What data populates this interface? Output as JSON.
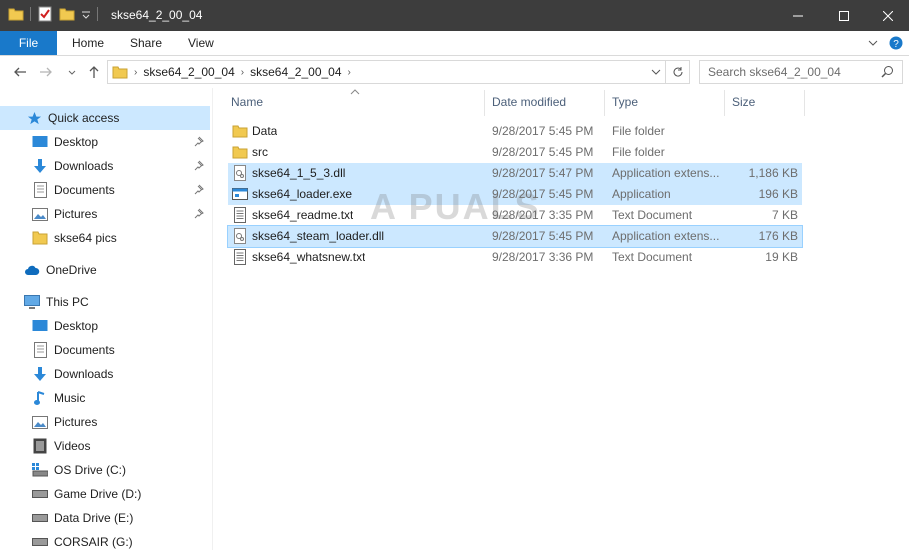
{
  "window": {
    "title": "skse64_2_00_04"
  },
  "ribbon": {
    "tabs": [
      "File",
      "Home",
      "Share",
      "View"
    ]
  },
  "nav": {
    "breadcrumbs": [
      "skse64_2_00_04",
      "skse64_2_00_04"
    ],
    "search_placeholder": "Search skse64_2_00_04"
  },
  "sidebar": {
    "quick_access": {
      "label": "Quick access"
    },
    "quick_items": [
      {
        "label": "Desktop",
        "icon": "desktop-icon",
        "pinned": true
      },
      {
        "label": "Downloads",
        "icon": "downloads-icon",
        "pinned": true
      },
      {
        "label": "Documents",
        "icon": "documents-icon",
        "pinned": true
      },
      {
        "label": "Pictures",
        "icon": "pictures-icon",
        "pinned": true
      },
      {
        "label": "skse64 pics",
        "icon": "folder-icon",
        "pinned": false
      }
    ],
    "onedrive": {
      "label": "OneDrive"
    },
    "this_pc": {
      "label": "This PC"
    },
    "pc_items": [
      {
        "label": "Desktop",
        "icon": "desktop-icon"
      },
      {
        "label": "Documents",
        "icon": "documents-icon"
      },
      {
        "label": "Downloads",
        "icon": "downloads-icon"
      },
      {
        "label": "Music",
        "icon": "music-icon"
      },
      {
        "label": "Pictures",
        "icon": "pictures-icon"
      },
      {
        "label": "Videos",
        "icon": "videos-icon"
      },
      {
        "label": "OS Drive (C:)",
        "icon": "os-drive-icon"
      },
      {
        "label": "Game Drive (D:)",
        "icon": "drive-icon"
      },
      {
        "label": "Data Drive (E:)",
        "icon": "drive-icon"
      },
      {
        "label": "CORSAIR (G:)",
        "icon": "drive-icon"
      }
    ]
  },
  "columns": {
    "name": "Name",
    "date": "Date modified",
    "type": "Type",
    "size": "Size"
  },
  "files": [
    {
      "name": "Data",
      "date": "9/28/2017 5:45 PM",
      "type": "File folder",
      "size": "",
      "icon": "folder-icon",
      "state": "none"
    },
    {
      "name": "src",
      "date": "9/28/2017 5:45 PM",
      "type": "File folder",
      "size": "",
      "icon": "folder-icon",
      "state": "none"
    },
    {
      "name": "skse64_1_5_3.dll",
      "date": "9/28/2017 5:47 PM",
      "type": "Application extens...",
      "size": "1,186 KB",
      "icon": "dll-icon",
      "state": "selected"
    },
    {
      "name": "skse64_loader.exe",
      "date": "9/28/2017 5:45 PM",
      "type": "Application",
      "size": "196 KB",
      "icon": "exe-icon",
      "state": "selected"
    },
    {
      "name": "skse64_readme.txt",
      "date": "9/28/2017 3:35 PM",
      "type": "Text Document",
      "size": "7 KB",
      "icon": "txt-icon",
      "state": "none"
    },
    {
      "name": "skse64_steam_loader.dll",
      "date": "9/28/2017 5:45 PM",
      "type": "Application extens...",
      "size": "176 KB",
      "icon": "dll-icon",
      "state": "focused"
    },
    {
      "name": "skse64_whatsnew.txt",
      "date": "9/28/2017 3:36 PM",
      "type": "Text Document",
      "size": "19 KB",
      "icon": "txt-icon",
      "state": "none"
    }
  ],
  "watermark": "A PUALS",
  "colors": {
    "file_tab": "#1979ca",
    "selection": "#cce8ff",
    "titlebar": "#3d3d3d"
  }
}
